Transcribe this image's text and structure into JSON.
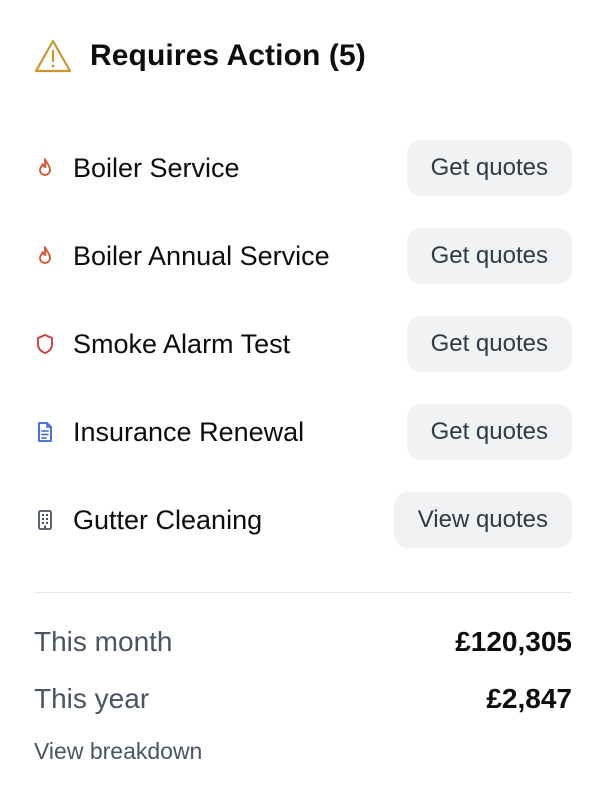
{
  "header": {
    "title": "Requires Action (5)",
    "icon": "warning-triangle-icon",
    "icon_color": "#c9972e"
  },
  "items": [
    {
      "label": "Boiler Service",
      "icon": "flame-icon",
      "icon_color": "#d9552b",
      "button": "Get quotes"
    },
    {
      "label": "Boiler Annual Service",
      "icon": "flame-icon",
      "icon_color": "#d9552b",
      "button": "Get quotes"
    },
    {
      "label": "Smoke Alarm Test",
      "icon": "shield-icon",
      "icon_color": "#d03a3a",
      "button": "Get quotes"
    },
    {
      "label": "Insurance Renewal",
      "icon": "document-icon",
      "icon_color": "#3b63d9",
      "button": "Get quotes"
    },
    {
      "label": "Gutter Cleaning",
      "icon": "building-icon",
      "icon_color": "#4a5462",
      "button": "View quotes"
    }
  ],
  "summary": {
    "month_label": "This month",
    "month_value": "£120,305",
    "year_label": "This year",
    "year_value": "£2,847",
    "link": "View breakdown"
  },
  "colors": {
    "button_bg": "#f1f2f4",
    "button_text": "#2f3a48",
    "muted_text": "#4a5462"
  }
}
